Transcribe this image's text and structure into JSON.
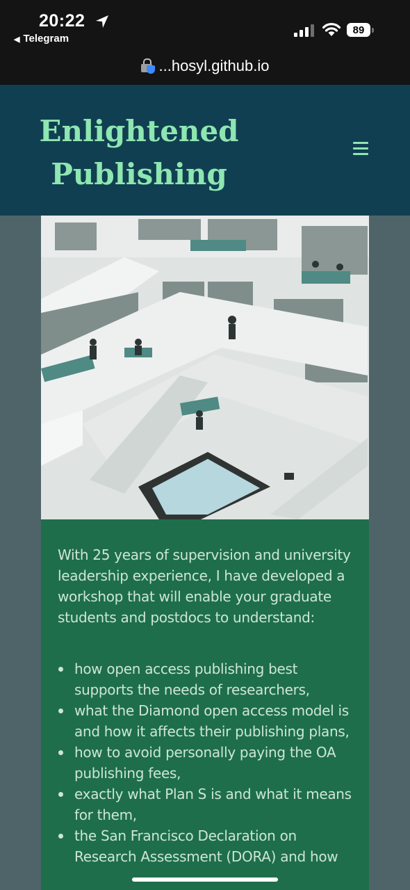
{
  "status_bar": {
    "time": "20:22",
    "back_app": "Telegram",
    "battery": "89",
    "signal_bars_active": 3,
    "signal_bars_total": 4,
    "url": "...hosyl.github.io"
  },
  "header": {
    "title_line1": "Enlightened",
    "title_line2": "Publishing",
    "menu_icon": "hamburger-menu-icon",
    "background": "#113f52",
    "title_color": "#8ee6b1"
  },
  "hero": {
    "image": "library-interior-photo"
  },
  "content": {
    "intro": "With 25 years of supervision and university leadership experience, I have developed a workshop that will enable your graduate students and postdocs to understand:",
    "bullets": [
      "how open access publishing best supports the needs of researchers,",
      "what the Diamond open access model is and how it affects their publishing plans,",
      "how to avoid personally paying the OA publishing fees,",
      "exactly what Plan S is and what it means for them,",
      "the San Francisco Declaration on Research Assessment (DORA) and how"
    ],
    "background": "#1e6e4b"
  }
}
